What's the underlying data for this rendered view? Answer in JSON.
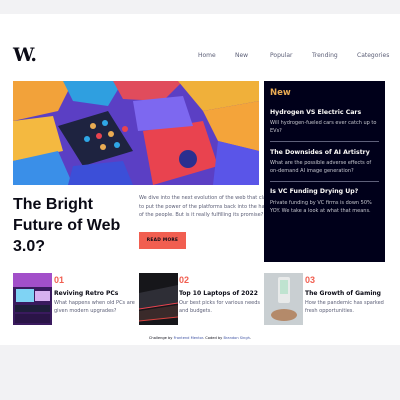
{
  "brand": {
    "logo": "W."
  },
  "nav": [
    "Home",
    "New",
    "Popular",
    "Trending",
    "Categories"
  ],
  "hero": {
    "title": "The Bright Future of Web 3.0?",
    "description": "We dive into the next evolution of the web that claims to put the power of the platforms back into the hands of the people. But is it really fulfilling its promise?",
    "button": "READ MORE"
  },
  "new_panel": {
    "heading": "New",
    "items": [
      {
        "title": "Hydrogen VS Electric Cars",
        "text": "Will hydrogen-fueled cars ever catch up to EVs?"
      },
      {
        "title": "The Downsides of AI Artistry",
        "text": "What are the possible adverse effects of on-demand AI image generation?"
      },
      {
        "title": "Is VC Funding Drying Up?",
        "text": "Private funding by VC firms is down 50% YOY. We take a look at what that means."
      }
    ]
  },
  "cards": [
    {
      "number": "01",
      "title": "Reviving Retro PCs",
      "text": "What happens when old PCs are given modern upgrades?"
    },
    {
      "number": "02",
      "title": "Top 10 Laptops of 2022",
      "text": "Our best picks for various needs and budgets."
    },
    {
      "number": "03",
      "title": "The Growth of Gaming",
      "text": "How the pandemic has sparked fresh opportunities."
    }
  ],
  "attribution": {
    "prefix": "Challenge by",
    "challenge_link": "Frontend Mentor",
    "middle": ". Coded by",
    "author_link": "Brandon Singh",
    "suffix": "."
  },
  "colors": {
    "accent_red": "#f15e50",
    "accent_orange": "#e9ab53",
    "dark_navy": "#00001a",
    "grayish_blue": "#5b5e76",
    "off_white": "#fffdfa"
  }
}
